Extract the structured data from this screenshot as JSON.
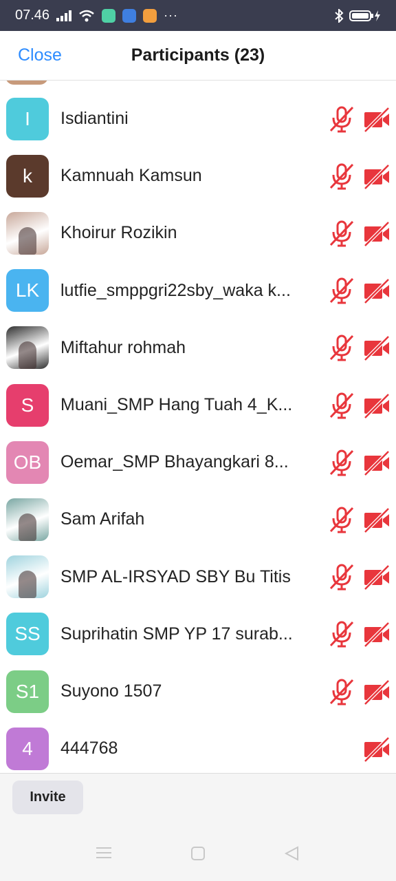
{
  "status_bar": {
    "time": "07.46",
    "battery_icon": "battery-charging-icon",
    "bluetooth_icon": "bluetooth-icon"
  },
  "header": {
    "close_label": "Close",
    "title": "Participants (23)"
  },
  "participants": [
    {
      "name": "Isdiantini",
      "initials": "I",
      "avatar_color": "#4fcbdc",
      "photo": false,
      "mic_muted": true,
      "video_off": true
    },
    {
      "name": "Kamnuah Kamsun",
      "initials": "k",
      "avatar_color": "#5b3a2c",
      "photo": false,
      "mic_muted": true,
      "video_off": true
    },
    {
      "name": "Khoirur Rozikin",
      "initials": "",
      "avatar_color": "#c8a89a",
      "photo": true,
      "mic_muted": true,
      "video_off": true
    },
    {
      "name": "lutfie_smppgri22sby_waka k...",
      "initials": "LK",
      "avatar_color": "#4ab4f0",
      "photo": false,
      "mic_muted": true,
      "video_off": true
    },
    {
      "name": "Miftahur rohmah",
      "initials": "",
      "avatar_color": "#2f2f2f",
      "photo": true,
      "mic_muted": true,
      "video_off": true
    },
    {
      "name": "Muani_SMP Hang Tuah 4_K...",
      "initials": "S",
      "avatar_color": "#e63e6d",
      "photo": false,
      "mic_muted": true,
      "video_off": true
    },
    {
      "name": "Oemar_SMP Bhayangkari 8...",
      "initials": "OB",
      "avatar_color": "#e387b3",
      "photo": false,
      "mic_muted": true,
      "video_off": true
    },
    {
      "name": "Sam Arifah",
      "initials": "",
      "avatar_color": "#7aa7a3",
      "photo": true,
      "mic_muted": true,
      "video_off": true
    },
    {
      "name": "SMP AL-IRSYAD SBY Bu Titis",
      "initials": "",
      "avatar_color": "#9fd3de",
      "photo": true,
      "mic_muted": true,
      "video_off": true
    },
    {
      "name": "Suprihatin SMP YP 17 surab...",
      "initials": "SS",
      "avatar_color": "#4fcbdc",
      "photo": false,
      "mic_muted": true,
      "video_off": true
    },
    {
      "name": "Suyono 1507",
      "initials": "S1",
      "avatar_color": "#7ccd86",
      "photo": false,
      "mic_muted": true,
      "video_off": true
    },
    {
      "name": "444768",
      "initials": "4",
      "avatar_color": "#c07ad6",
      "photo": false,
      "mic_muted": false,
      "video_off": true
    }
  ],
  "footer": {
    "invite_label": "Invite"
  },
  "colors": {
    "accent": "#2d8cff",
    "muted_red": "#e8363c"
  }
}
